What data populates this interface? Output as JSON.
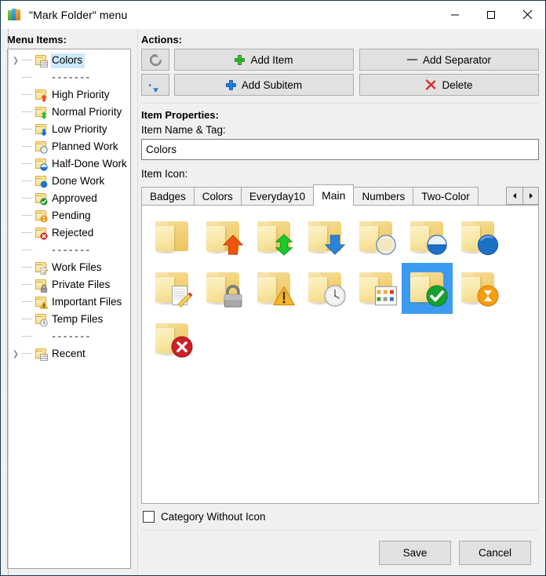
{
  "window": {
    "title": "\"Mark Folder\" menu",
    "app_icon": "colored-blocks-icon",
    "controls": {
      "minimize": "minimize-icon",
      "maximize": "maximize-icon",
      "close": "close-icon"
    }
  },
  "left": {
    "label": "Menu Items:",
    "tree": [
      {
        "label": "Colors",
        "icon": "folder-grid-icon",
        "expander": true,
        "selected": true,
        "type": "item"
      },
      {
        "label": "-------",
        "icon": "",
        "expander": false,
        "selected": false,
        "type": "separator"
      },
      {
        "label": "High Priority",
        "icon": "folder-up-arrow-icon",
        "expander": false,
        "selected": false,
        "type": "item"
      },
      {
        "label": "Normal Priority",
        "icon": "folder-updown-icon",
        "expander": false,
        "selected": false,
        "type": "item"
      },
      {
        "label": "Low Priority",
        "icon": "folder-down-arrow-icon",
        "expander": false,
        "selected": false,
        "type": "item"
      },
      {
        "label": "Planned Work",
        "icon": "folder-empty-circle-icon",
        "expander": false,
        "selected": false,
        "type": "item"
      },
      {
        "label": "Half-Done Work",
        "icon": "folder-half-circle-icon",
        "expander": false,
        "selected": false,
        "type": "item"
      },
      {
        "label": "Done Work",
        "icon": "folder-full-circle-icon",
        "expander": false,
        "selected": false,
        "type": "item"
      },
      {
        "label": "Approved",
        "icon": "folder-check-icon",
        "expander": false,
        "selected": false,
        "type": "item"
      },
      {
        "label": "Pending",
        "icon": "folder-hourglass-icon",
        "expander": false,
        "selected": false,
        "type": "item"
      },
      {
        "label": "Rejected",
        "icon": "folder-x-icon",
        "expander": false,
        "selected": false,
        "type": "item"
      },
      {
        "label": "-------",
        "icon": "",
        "expander": false,
        "selected": false,
        "type": "separator"
      },
      {
        "label": "Work Files",
        "icon": "folder-document-icon",
        "expander": false,
        "selected": false,
        "type": "item"
      },
      {
        "label": "Private Files",
        "icon": "folder-lock-icon",
        "expander": false,
        "selected": false,
        "type": "item"
      },
      {
        "label": "Important Files",
        "icon": "folder-warning-icon",
        "expander": false,
        "selected": false,
        "type": "item"
      },
      {
        "label": "Temp Files",
        "icon": "folder-clock-icon",
        "expander": false,
        "selected": false,
        "type": "item"
      },
      {
        "label": "-------",
        "icon": "",
        "expander": false,
        "selected": false,
        "type": "separator"
      },
      {
        "label": "Recent",
        "icon": "folder-grid-icon",
        "expander": true,
        "selected": false,
        "type": "item"
      }
    ]
  },
  "actions": {
    "label": "Actions:",
    "move_up": "move-up-icon",
    "move_down": "move-down-icon",
    "add_item": "Add Item",
    "add_separator": "Add Separator",
    "add_subitem": "Add Subitem",
    "delete": "Delete"
  },
  "properties": {
    "label": "Item Properties:",
    "name_label": "Item Name & Tag:",
    "name_value": "Colors",
    "name_placeholder": "",
    "icon_label": "Item Icon:"
  },
  "tabs": {
    "items": [
      {
        "label": "Badges",
        "active": false
      },
      {
        "label": "Colors",
        "active": false
      },
      {
        "label": "Everyday10",
        "active": false
      },
      {
        "label": "Main",
        "active": true
      },
      {
        "label": "Numbers",
        "active": false
      },
      {
        "label": "Two-Color",
        "active": false
      }
    ],
    "scroll_left": "triangle-left-icon",
    "scroll_right": "triangle-right-icon"
  },
  "icon_grid": {
    "selected_index": 12,
    "icons": [
      {
        "name": "folder-plain-icon",
        "badge": "none"
      },
      {
        "name": "folder-up-arrow-icon",
        "badge": "arrow-up"
      },
      {
        "name": "folder-updown-arrow-icon",
        "badge": "arrow-updown"
      },
      {
        "name": "folder-down-arrow-icon",
        "badge": "arrow-down"
      },
      {
        "name": "folder-empty-circle-icon",
        "badge": "circle-empty"
      },
      {
        "name": "folder-half-circle-icon",
        "badge": "circle-half"
      },
      {
        "name": "folder-full-circle-icon",
        "badge": "circle-full"
      },
      {
        "name": "folder-document-icon",
        "badge": "document-pencil"
      },
      {
        "name": "folder-lock-icon",
        "badge": "lock"
      },
      {
        "name": "folder-warning-icon",
        "badge": "warning"
      },
      {
        "name": "folder-clock-icon",
        "badge": "clock"
      },
      {
        "name": "folder-grid-icon",
        "badge": "grid"
      },
      {
        "name": "folder-check-icon",
        "badge": "check"
      },
      {
        "name": "folder-hourglass-icon",
        "badge": "hourglass"
      },
      {
        "name": "folder-x-icon",
        "badge": "cross"
      }
    ]
  },
  "category": {
    "label": "Category Without Icon",
    "checked": false
  },
  "footer": {
    "save": "Save",
    "cancel": "Cancel"
  },
  "colors": {
    "selection_blue": "#3b9bf0",
    "tree_selection": "#cde8ff",
    "window_border": "#12395c",
    "panel_bg": "#f0f0f0",
    "button_bg": "#e1e1e1"
  }
}
